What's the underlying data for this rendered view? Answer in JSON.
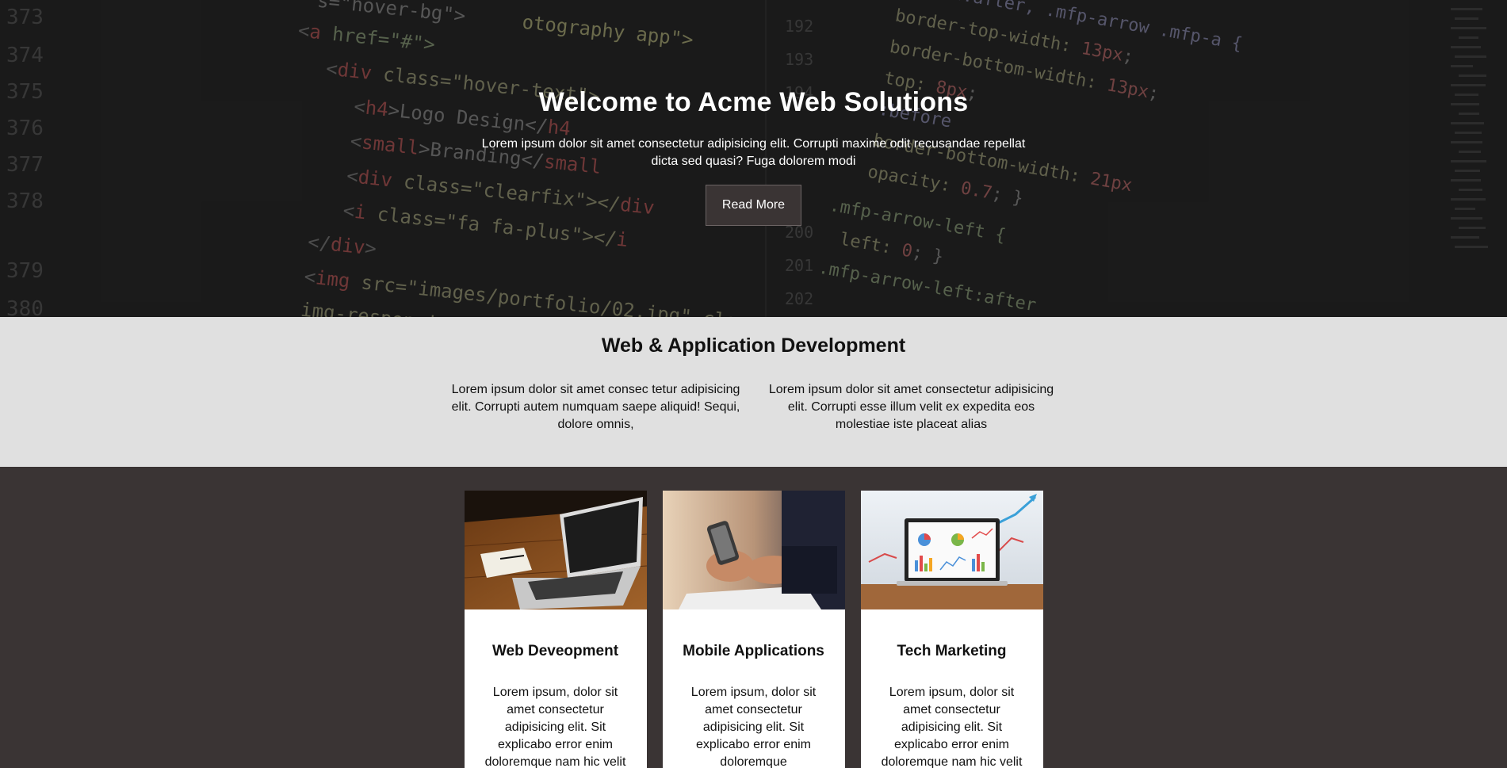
{
  "hero": {
    "title": "Welcome to Acme Web Solutions",
    "text": "Lorem ipsum dolor sit amet consectetur adipisicing elit. Corrupti maxime odit recusandae repellat dicta sed quasi? Fuga dolorem modi",
    "button_label": "Read More"
  },
  "services": {
    "title": "Web & Application Development",
    "columns": [
      "Lorem ipsum dolor sit amet consec tetur adipisicing elit. Corrupti autem numquam saepe aliquid! Sequi, dolore omnis,",
      "Lorem ipsum dolor sit amet consectetur adipisicing elit. Corrupti esse illum velit ex expedita eos molestiae iste placeat alias"
    ]
  },
  "cards": [
    {
      "title": "Web Deveopment",
      "text": "Lorem ipsum, dolor sit amet consectetur adipisicing elit. Sit explicabo error enim doloremque nam hic velit",
      "image": "laptop-on-desk-image"
    },
    {
      "title": "Mobile Applications",
      "text": "Lorem ipsum, dolor sit amet consectetur adipisicing elit. Sit explicabo error enim doloremque",
      "image": "hands-holding-phone-image"
    },
    {
      "title": "Tech Marketing",
      "text": "Lorem ipsum, dolor sit amet consectetur adipisicing elit. Sit explicabo error enim doloremque nam hic velit",
      "image": "laptop-with-charts-image"
    }
  ],
  "colors": {
    "hero_bg": "#1f1f1f",
    "services_bg": "#e0e0e0",
    "cards_bg": "#3a3434",
    "button_bg": "#3a3434"
  }
}
